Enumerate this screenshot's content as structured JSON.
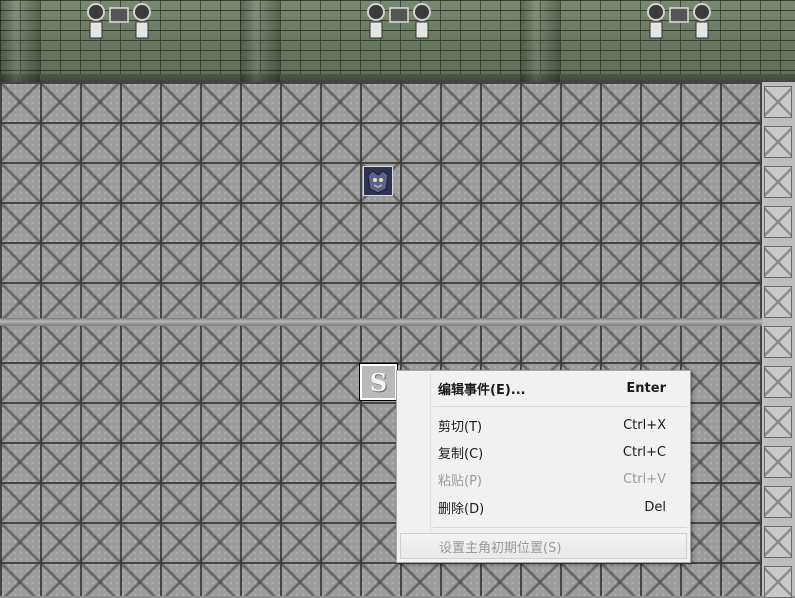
{
  "map": {
    "start_marker_label": "S"
  },
  "context_menu": {
    "items": [
      {
        "label": "编辑事件(E)...",
        "shortcut": "Enter",
        "enabled": true
      },
      {
        "label": "剪切(T)",
        "shortcut": "Ctrl+X",
        "enabled": true
      },
      {
        "label": "复制(C)",
        "shortcut": "Ctrl+C",
        "enabled": true
      },
      {
        "label": "粘贴(P)",
        "shortcut": "Ctrl+V",
        "enabled": false
      },
      {
        "label": "删除(D)",
        "shortcut": "Del",
        "enabled": true
      },
      {
        "label": "设置主角初期位置(S)",
        "shortcut": "",
        "enabled": false
      }
    ]
  },
  "colors": {
    "menu_background": "#f1f1f1",
    "disabled_text": "#9a9a9a",
    "wall": "#6e7b66",
    "floor": "#9c9c9c"
  },
  "icons": {
    "wall_lamp": "wall-lamp-icon",
    "character": "character-sprite-icon"
  }
}
